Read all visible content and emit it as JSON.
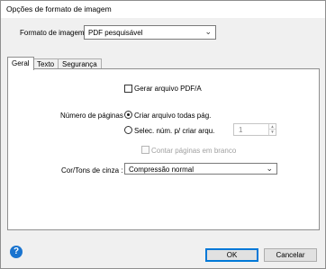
{
  "window": {
    "title": "Opções de formato de imagem"
  },
  "format": {
    "label": "Formato de imagem :",
    "selected": "PDF pesquisável"
  },
  "tabs": [
    {
      "label": "Geral",
      "active": true
    },
    {
      "label": "Texto",
      "active": false
    },
    {
      "label": "Segurança",
      "active": false
    }
  ],
  "general": {
    "create_pdfa_label": "Gerar arquivo PDF/A",
    "create_pdfa_checked": false,
    "pages": {
      "label": "Número de páginas :",
      "all_pages_label": "Criar arquivo todas pág.",
      "all_pages_selected": true,
      "select_label": "Selec. núm. p/ criar arqu.",
      "select_selected": false,
      "count_value": "1",
      "count_blank_label": "Contar páginas em branco",
      "count_blank_checked": false
    },
    "color": {
      "label": "Cor/Tons de cinza :",
      "selected": "Compressão normal"
    }
  },
  "footer": {
    "help_symbol": "?",
    "ok_label": "OK",
    "cancel_label": "Cancelar"
  },
  "colors": {
    "accent": "#0078d7",
    "help_icon": "#1a74cf"
  }
}
